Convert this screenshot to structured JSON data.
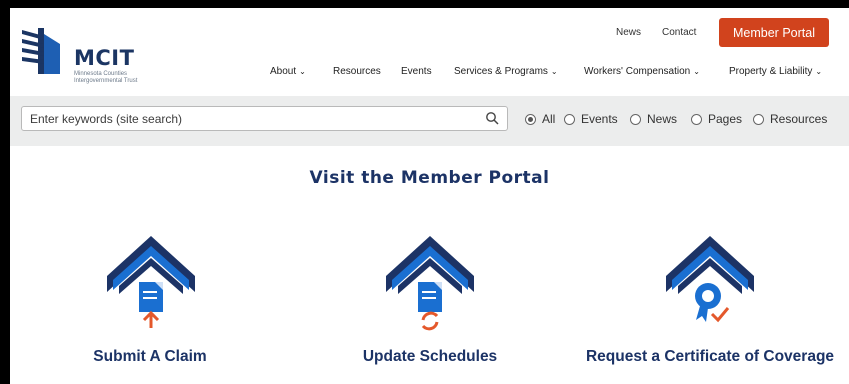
{
  "header": {
    "logo": {
      "name": "MCIT",
      "subtitle": "Minnesota Counties Intergovernmental Trust"
    },
    "utility_links": [
      "News",
      "Contact"
    ],
    "member_portal_label": "Member Portal",
    "nav": [
      "About",
      "Resources",
      "Events",
      "Services & Programs",
      "Workers' Compensation",
      "Property & Liability"
    ]
  },
  "search": {
    "placeholder": "Enter keywords (site search)",
    "icon": "search-icon",
    "filters": [
      "All",
      "Events",
      "News",
      "Pages",
      "Resources"
    ],
    "selected_filter": "All"
  },
  "main": {
    "title": "Visit the Member Portal",
    "cards": [
      {
        "label": "Submit A Claim",
        "icon": "submit-claim-icon"
      },
      {
        "label": "Update Schedules",
        "icon": "update-schedules-icon"
      },
      {
        "label": "Request a Certificate of Coverage",
        "icon": "certificate-icon"
      }
    ]
  },
  "colors": {
    "navy": "#1c3366",
    "blue": "#1a6fd1",
    "orange": "#d1431d",
    "searchbar_bg": "#eceded"
  }
}
